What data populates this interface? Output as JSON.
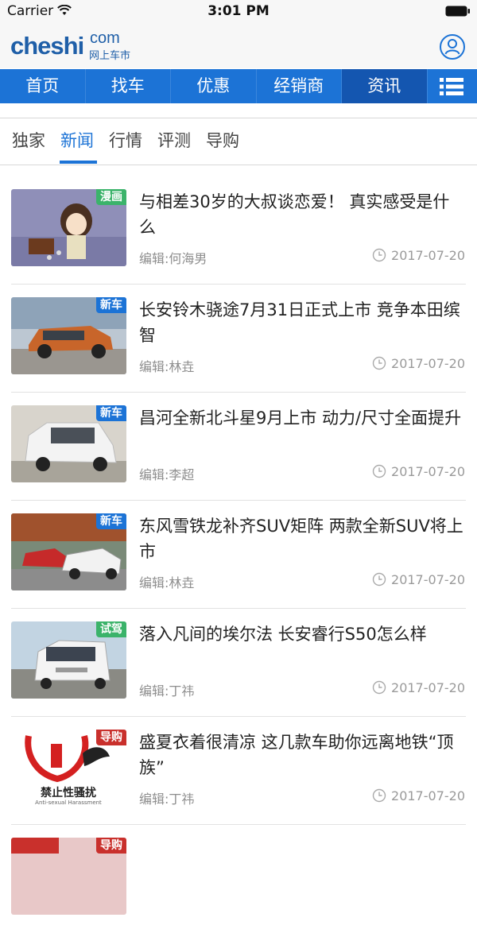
{
  "status_bar": {
    "carrier": "Carrier",
    "time": "3:01 PM"
  },
  "header": {
    "logo_main_a": "cheshi",
    "logo_com": "com",
    "logo_sub": "网上车市",
    "user_icon": "user-circle-icon"
  },
  "main_nav": {
    "items": [
      {
        "label": "首页"
      },
      {
        "label": "找车"
      },
      {
        "label": "优惠"
      },
      {
        "label": "经销商"
      },
      {
        "label": "资讯"
      }
    ],
    "active_index": 4,
    "menu_icon": "list-menu-icon",
    "colors": {
      "bar": "#1c73d6",
      "active": "#1456b0"
    }
  },
  "sub_tabs": {
    "items": [
      {
        "label": "独家"
      },
      {
        "label": "新闻"
      },
      {
        "label": "行情"
      },
      {
        "label": "评测"
      },
      {
        "label": "导购"
      }
    ],
    "active_index": 1
  },
  "news": [
    {
      "badge": "漫画",
      "title": "与相差30岁的大叔谈恋爱！ 真实感受是什么",
      "editor": "编辑:何海男",
      "date": "2017-07-20"
    },
    {
      "badge": "新车",
      "title": "长安铃木骁途7月31日正式上市 竞争本田缤智",
      "editor": "编辑:林垚",
      "date": "2017-07-20"
    },
    {
      "badge": "新车",
      "title": "昌河全新北斗星9月上市 动力/尺寸全面提升",
      "editor": "编辑:李超",
      "date": "2017-07-20"
    },
    {
      "badge": "新车",
      "title": "东风雪铁龙补齐SUV矩阵 两款全新SUV将上市",
      "editor": "编辑:林垚",
      "date": "2017-07-20"
    },
    {
      "badge": "试驾",
      "title": "落入凡间的埃尔法 长安睿行S50怎么样",
      "editor": "编辑:丁祎",
      "date": "2017-07-20"
    },
    {
      "badge": "导购",
      "title": "盛夏衣着很清凉 这几款车助你远离地铁“顶族”",
      "editor": "编辑:丁祎",
      "date": "2017-07-20",
      "thumb_caption": "禁止性骚扰",
      "thumb_caption_en": "Anti-sexual Harassment"
    },
    {
      "badge": "导购",
      "title": "",
      "editor": "",
      "date": ""
    }
  ]
}
